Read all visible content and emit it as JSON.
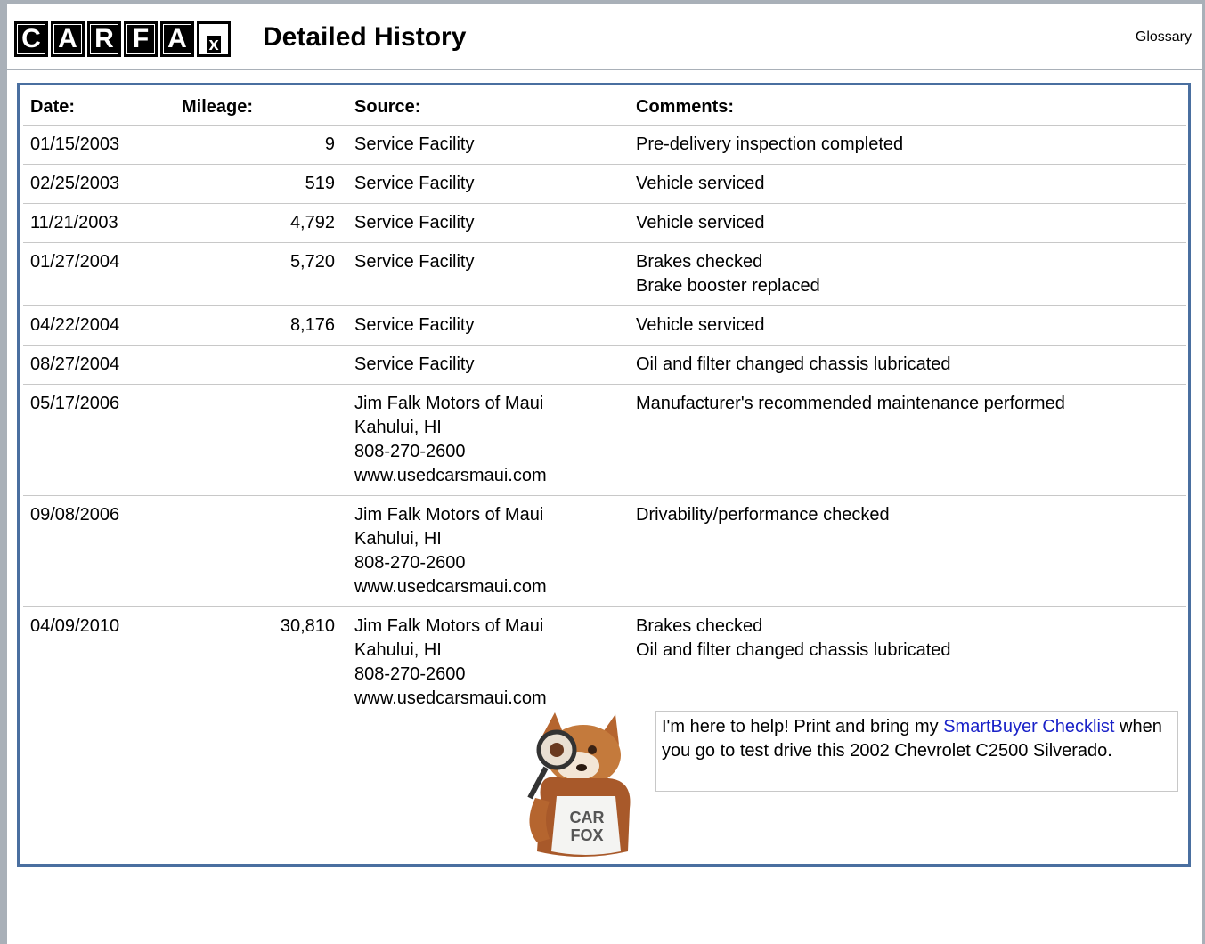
{
  "header": {
    "logo_letters": [
      "C",
      "A",
      "R",
      "F",
      "A",
      "x"
    ],
    "title": "Detailed History",
    "glossary_link": "Glossary"
  },
  "table": {
    "columns": [
      "Date:",
      "Mileage:",
      "Source:",
      "Comments:"
    ],
    "rows": [
      {
        "date": "01/15/2003",
        "mileage": "9",
        "source": [
          "Service Facility"
        ],
        "comments": [
          "Pre-delivery inspection completed"
        ]
      },
      {
        "date": "02/25/2003",
        "mileage": "519",
        "source": [
          "Service Facility"
        ],
        "comments": [
          "Vehicle serviced"
        ]
      },
      {
        "date": "11/21/2003",
        "mileage": "4,792",
        "source": [
          "Service Facility"
        ],
        "comments": [
          "Vehicle serviced"
        ]
      },
      {
        "date": "01/27/2004",
        "mileage": "5,720",
        "source": [
          "Service Facility"
        ],
        "comments": [
          "Brakes checked",
          "Brake booster replaced"
        ]
      },
      {
        "date": "04/22/2004",
        "mileage": "8,176",
        "source": [
          "Service Facility"
        ],
        "comments": [
          "Vehicle serviced"
        ]
      },
      {
        "date": "08/27/2004",
        "mileage": "",
        "source": [
          "Service Facility"
        ],
        "comments": [
          "Oil and filter changed chassis lubricated"
        ]
      },
      {
        "date": "05/17/2006",
        "mileage": "",
        "source": [
          "Jim Falk Motors of Maui",
          "Kahului, HI",
          "808-270-2600",
          "www.usedcarsmaui.com"
        ],
        "comments": [
          "Manufacturer's recommended maintenance performed"
        ]
      },
      {
        "date": "09/08/2006",
        "mileage": "",
        "source": [
          "Jim Falk Motors of Maui",
          "Kahului, HI",
          "808-270-2600",
          "www.usedcarsmaui.com"
        ],
        "comments": [
          "Drivability/performance checked"
        ]
      },
      {
        "date": "04/09/2010",
        "mileage": "30,810",
        "source": [
          "Jim Falk Motors of Maui",
          "Kahului, HI",
          "808-270-2600",
          "www.usedcarsmaui.com"
        ],
        "comments": [
          "Brakes checked",
          "Oil and filter changed chassis lubricated"
        ]
      }
    ]
  },
  "help": {
    "prefix": "I'm here to help! Print and bring my ",
    "link": "SmartBuyer Checklist",
    "suffix": " when you go to test drive this 2002 Chevrolet C2500 Silverado.",
    "link_color": "#1a22c8"
  },
  "mascot": {
    "shirt_line1": "CAR",
    "shirt_line2": "FOX"
  },
  "colors": {
    "frame_border": "#a9b0b8",
    "box_border": "#4a6fa0"
  }
}
